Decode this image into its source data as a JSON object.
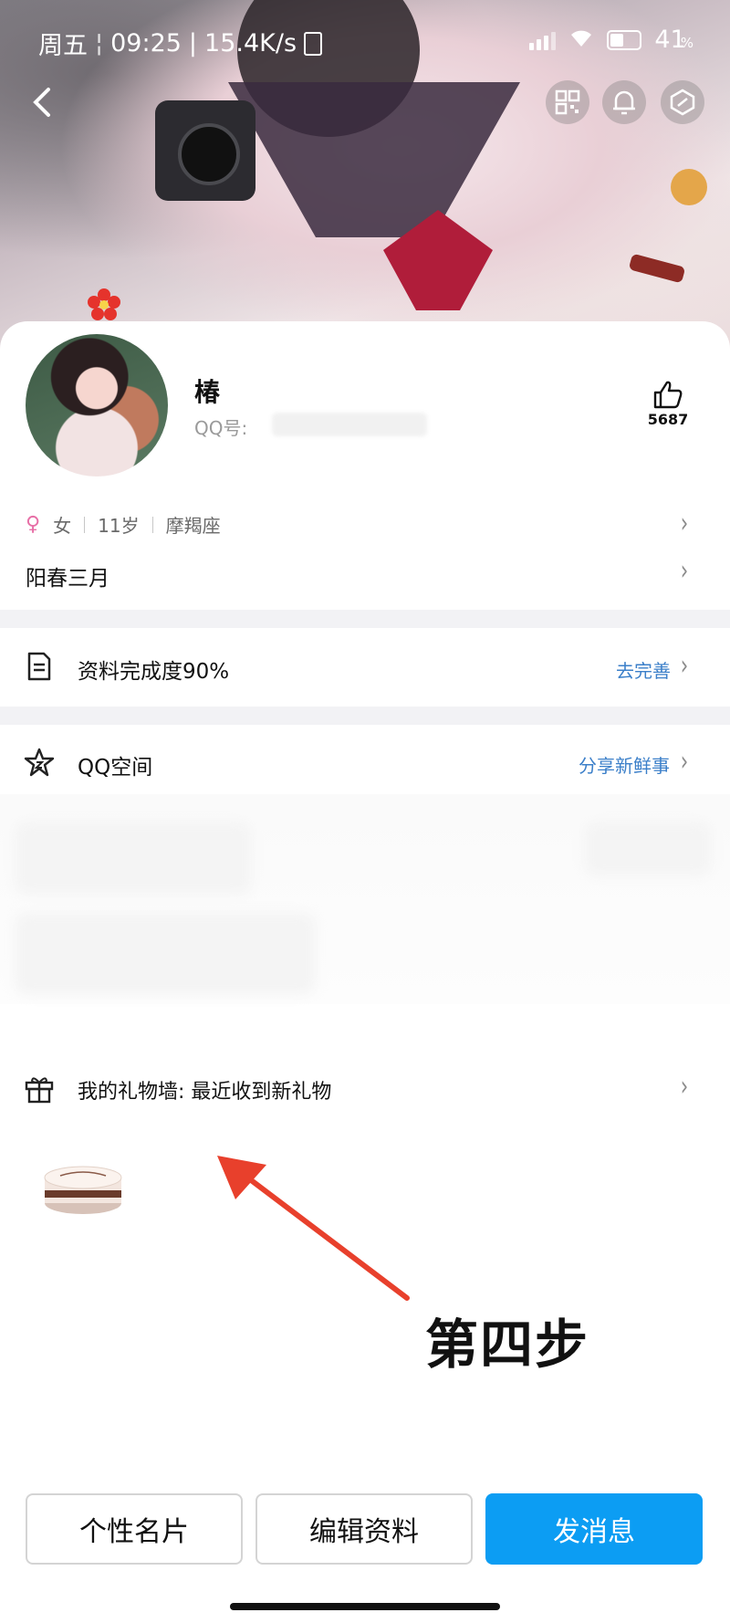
{
  "status_bar": {
    "weekday": "周五",
    "time": "09:25",
    "speed": "15.4K/s",
    "battery_pct": "41",
    "battery_unit": "%"
  },
  "profile": {
    "name": "椿",
    "qq_label": "QQ号:",
    "likes": "5687",
    "gender": "女",
    "age": "11岁",
    "zodiac": "摩羯座",
    "signature": "阳春三月"
  },
  "rows": {
    "completion_label": "资料完成度90%",
    "completion_action": "去完善",
    "qzone_label": "QQ空间",
    "qzone_action": "分享新鲜事",
    "gift_wall_label": "我的礼物墙: 最近收到新礼物"
  },
  "annotation": {
    "text": "第四步",
    "color": "#e8402c"
  },
  "buttons": {
    "card": "个性名片",
    "edit": "编辑资料",
    "message": "发消息"
  },
  "colors": {
    "accent": "#0c9df3",
    "link": "#3b7fc9",
    "gender_female": "#e76fa6"
  }
}
